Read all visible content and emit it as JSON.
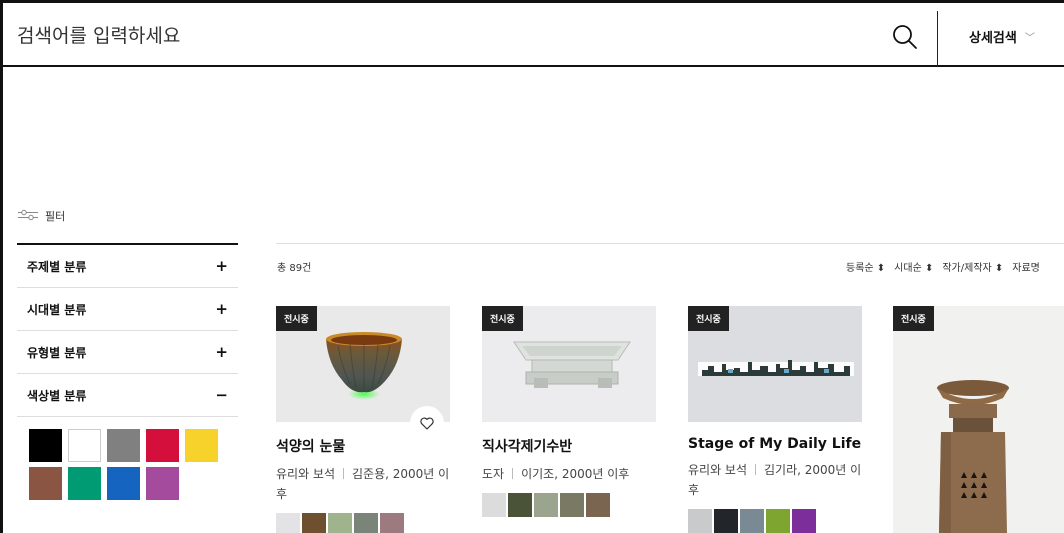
{
  "search": {
    "placeholder": "검색어를 입력하세요"
  },
  "header": {
    "detail_search_label": "상세검색",
    "detail_search_chevron": "﹀"
  },
  "filter": {
    "label": "필터"
  },
  "sidebar": {
    "categories": [
      {
        "label": "주제별 분류",
        "toggle": "+"
      },
      {
        "label": "시대별 분류",
        "toggle": "+"
      },
      {
        "label": "유형별 분류",
        "toggle": "+"
      },
      {
        "label": "색상별 분류",
        "toggle": "−"
      }
    ],
    "colors": [
      "#000000",
      "#ffffff",
      "#808080",
      "#d40f3c",
      "#f7d22a",
      "#8b5544",
      "#009a73",
      "#1565c0",
      "#a44b9e"
    ]
  },
  "results": {
    "total": "총 89건",
    "sort_options": [
      "등록순 ⬍",
      "시대순 ⬍",
      "작가/제작자 ⬍",
      "자료명"
    ]
  },
  "cards": [
    {
      "badge": "전시중",
      "title": "석양의 눈물",
      "category": "유리와 보석",
      "artist_period": "김준용, 2000년 이후",
      "colors": [
        "#e3e3e5",
        "#6e5031",
        "#9fb38c",
        "#7a8479",
        "#9c7a80"
      ]
    },
    {
      "badge": "전시중",
      "title": "직사각제기수반",
      "category": "도자",
      "artist_period": "이기조, 2000년 이후",
      "colors": [
        "#dcdcdc",
        "#4a5238",
        "#9ba48e",
        "#7a7a64",
        "#7a6650"
      ]
    },
    {
      "badge": "전시중",
      "title": "Stage of My Daily Life",
      "category": "유리와 보석",
      "artist_period": "김기라, 2000년 이후",
      "colors": [
        "#c9cacc",
        "#22262a",
        "#7a8a94",
        "#7da52f",
        "#7c2f9a"
      ]
    },
    {
      "badge": "전시중"
    }
  ]
}
